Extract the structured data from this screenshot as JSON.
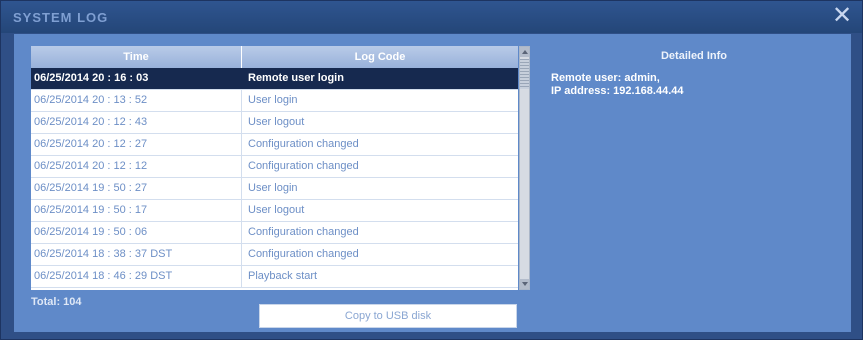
{
  "window": {
    "title": "SYSTEM LOG",
    "close_glyph": "✕"
  },
  "table": {
    "columns": [
      "Time",
      "Log Code"
    ],
    "selected_index": 0,
    "rows": [
      {
        "time": "06/25/2014  20 : 16 : 03",
        "code": "Remote user login"
      },
      {
        "time": "06/25/2014  20 : 13 : 52",
        "code": "User login"
      },
      {
        "time": "06/25/2014  20 : 12 : 43",
        "code": "User logout"
      },
      {
        "time": "06/25/2014  20 : 12 : 27",
        "code": "Configuration changed"
      },
      {
        "time": "06/25/2014  20 : 12 : 12",
        "code": "Configuration changed"
      },
      {
        "time": "06/25/2014  19 : 50 : 27",
        "code": "User login"
      },
      {
        "time": "06/25/2014  19 : 50 : 17",
        "code": "User logout"
      },
      {
        "time": "06/25/2014  19 : 50 : 06",
        "code": "Configuration changed"
      },
      {
        "time": "06/25/2014  18 : 38 : 37  DST",
        "code": "Configuration changed"
      },
      {
        "time": "06/25/2014  18 : 46 : 29  DST",
        "code": "Playback start"
      }
    ]
  },
  "footer": {
    "total": "Total: 104",
    "copy_button": "Copy to USB disk"
  },
  "detail": {
    "title": "Detailed Info",
    "lines": [
      "Remote user: admin,",
      "IP address: 192.168.44.44"
    ]
  },
  "colors": {
    "frame": "#2f4f86",
    "panel": "#5f89c9",
    "selected_row": "#16294f",
    "row_text": "#6d8fc6"
  }
}
